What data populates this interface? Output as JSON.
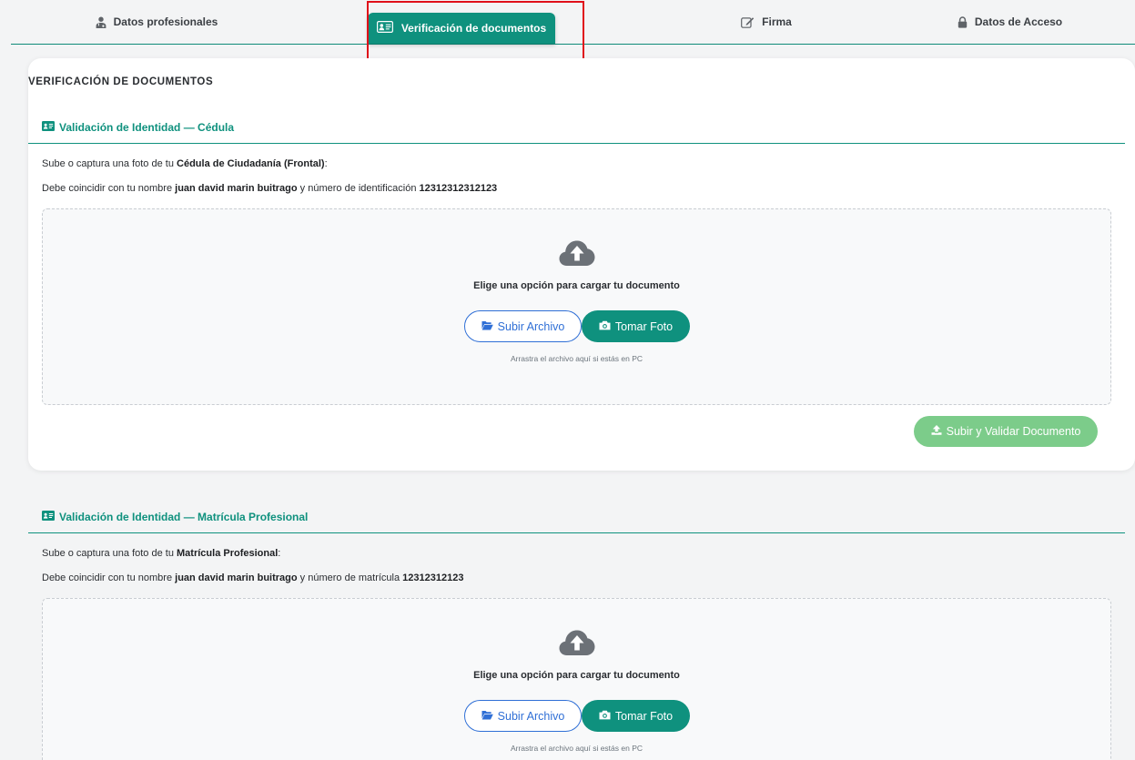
{
  "tabs": {
    "professional": "Datos profesionales",
    "documents": "Verificación de documentos",
    "signature": "Firma",
    "access": "Datos de Acceso"
  },
  "card": {
    "title": "VERIFICACIÓN DE DOCUMENTOS"
  },
  "cedula": {
    "heading": "Validación de Identidad — Cédula",
    "prompt_prefix": "Sube o captura una foto de tu ",
    "prompt_doc": "Cédula de Ciudadanía (Frontal)",
    "prompt_suffix": ":",
    "match_prefix": "Debe coincidir con tu nombre ",
    "match_name": "juan david marin buitrago",
    "match_middle": " y número de identificación ",
    "match_number": "12312312312123",
    "choose_label": "Elige una opción para cargar tu documento",
    "upload_label": "Subir Archivo",
    "photo_label": "Tomar Foto",
    "hint": "Arrastra el archivo aquí si estás en PC",
    "validate_label": "Subir y Validar Documento"
  },
  "matricula": {
    "heading": "Validación de Identidad — Matrícula Profesional",
    "prompt_prefix": "Sube o captura una foto de tu ",
    "prompt_doc": "Matrícula Profesional",
    "prompt_suffix": ":",
    "match_prefix": "Debe coincidir con tu nombre ",
    "match_name": "juan david marin buitrago",
    "match_middle": " y número de matrícula ",
    "match_number": "12312312123",
    "choose_label": "Elige una opción para cargar tu documento",
    "upload_label": "Subir Archivo",
    "photo_label": "Tomar Foto",
    "hint": "Arrastra el archivo aquí si estás en PC"
  },
  "icons": {
    "tab_professional": "user-doctor-icon",
    "tab_documents": "id-card-icon",
    "tab_signature": "edit-icon",
    "tab_access": "lock-icon",
    "section": "id-card-icon",
    "upload": "cloud-upload-icon",
    "folder": "folder-open-icon",
    "camera": "camera-icon",
    "validate": "upload-icon"
  },
  "colors": {
    "primary": "#0f917e",
    "link_blue": "#2f6fd6",
    "validate_green": "#7ccc8a",
    "highlight_red": "#e0101a"
  }
}
